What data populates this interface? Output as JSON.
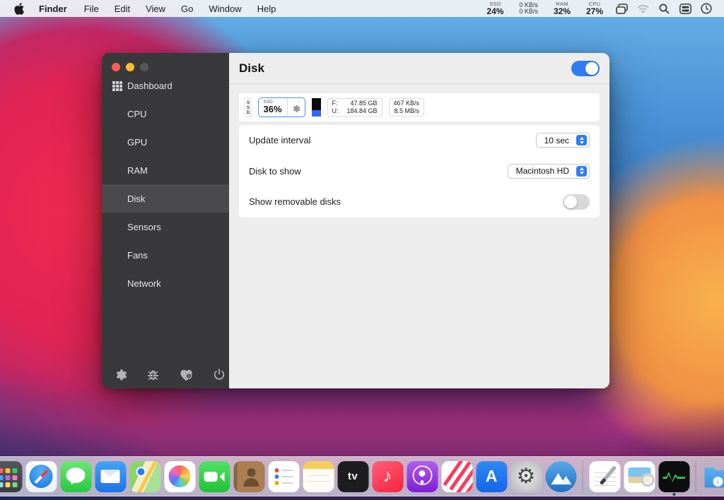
{
  "menu_bar": {
    "app_menu_items": [
      {
        "label": "Finder",
        "bold": true
      },
      {
        "label": "File"
      },
      {
        "label": "Edit"
      },
      {
        "label": "View"
      },
      {
        "label": "Go"
      },
      {
        "label": "Window"
      },
      {
        "label": "Help"
      }
    ],
    "status": {
      "ssd": {
        "label": "SSD",
        "value": "24%"
      },
      "network": {
        "up": "0 KB/s",
        "down": "0 KB/s"
      },
      "ram": {
        "label": "RAM",
        "value": "32%"
      },
      "cpu": {
        "label": "CPU",
        "value": "27%"
      }
    },
    "icons": [
      "windows-stack",
      "wifi",
      "search",
      "control-center",
      "clock"
    ]
  },
  "window": {
    "header": {
      "title": "Disk",
      "module_enabled": true
    },
    "sidebar": {
      "items": [
        "Dashboard",
        "CPU",
        "GPU",
        "RAM",
        "Disk",
        "Sensors",
        "Fans",
        "Network"
      ],
      "selected": "Disk",
      "tools": [
        "settings",
        "bug-report",
        "donate",
        "quit"
      ]
    },
    "widget_bar": {
      "mini_label": "SSD",
      "percent_widget": {
        "label": "SSD",
        "value": "36%"
      },
      "usage_widget": {
        "free_prefix": "F:",
        "free_value": "47.85 GB",
        "used_prefix": "U:",
        "used_value": "184.84 GB"
      },
      "speed_widget": {
        "line1": "467 KB/s",
        "line2": "8.5 MB/s"
      }
    },
    "settings": {
      "update_interval": {
        "label": "Update interval",
        "value": "10 sec"
      },
      "disk_to_show": {
        "label": "Disk to show",
        "value": "Macintosh HD"
      },
      "show_removable": {
        "label": "Show removable disks",
        "enabled": false
      }
    }
  },
  "dock": {
    "items": [
      {
        "name": "finder",
        "running": true
      },
      {
        "name": "launchpad"
      },
      {
        "name": "safari"
      },
      {
        "name": "messages"
      },
      {
        "name": "mail"
      },
      {
        "name": "maps"
      },
      {
        "name": "photos"
      },
      {
        "name": "facetime"
      },
      {
        "name": "contacts"
      },
      {
        "name": "reminders"
      },
      {
        "name": "notes"
      },
      {
        "name": "tv",
        "glyph": "tv"
      },
      {
        "name": "music",
        "glyph": "♪"
      },
      {
        "name": "podcasts"
      },
      {
        "name": "news"
      },
      {
        "name": "appstore",
        "glyph": "A"
      },
      {
        "name": "sysprefs",
        "glyph": "⚙"
      },
      {
        "name": "mountain"
      },
      {
        "name": "separator"
      },
      {
        "name": "textedit"
      },
      {
        "name": "preview"
      },
      {
        "name": "activity",
        "running": true
      },
      {
        "name": "separator"
      },
      {
        "name": "downloads",
        "glyph": "↓"
      },
      {
        "name": "trash"
      }
    ]
  },
  "colors": {
    "accent_blue": "#2f7cf6",
    "widget_selection_border": "#4a90e8",
    "sidebar_bg": "#39393b",
    "sidebar_selected_bg": "#4a4a4d",
    "bar_fill_blue": "#2f6df6",
    "traffic_red": "#ff5f57",
    "traffic_yellow": "#febc2e"
  }
}
